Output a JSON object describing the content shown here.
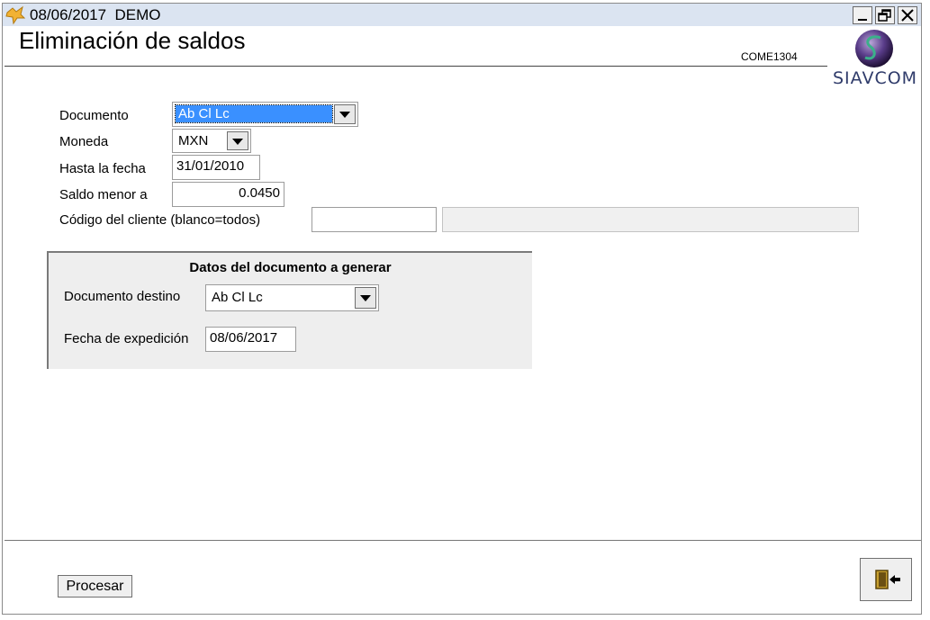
{
  "window": {
    "title": "08/06/2017  DEMO",
    "controls": {
      "minimize": "minimize",
      "restore": "restore",
      "close": "close"
    }
  },
  "header": {
    "title": "Eliminación de saldos",
    "form_code": "COME1304",
    "logo_text": "SIAVCOM"
  },
  "form": {
    "documento_label": "Documento",
    "documento_value": "Ab Cl Lc",
    "moneda_label": "Moneda",
    "moneda_value": "MXN",
    "hasta_label": "Hasta la fecha",
    "hasta_value": "31/01/2010",
    "saldo_label": "Saldo  menor a",
    "saldo_value": "0.0450",
    "cliente_label": "Código del cliente (blanco=todos)",
    "cliente_code_value": "",
    "cliente_name_value": ""
  },
  "panel": {
    "title": "Datos del documento a generar",
    "destino_label": "Documento destino",
    "destino_value": "Ab Cl Lc",
    "expedicion_label": "Fecha de expedición",
    "expedicion_value": "08/06/2017"
  },
  "footer": {
    "procesar_label": "Procesar",
    "exit_icon": "exit-door-icon"
  },
  "colors": {
    "titlebar": "#dbe4f1",
    "selection": "#3a90ff",
    "panel_bg": "#eeeeee"
  }
}
